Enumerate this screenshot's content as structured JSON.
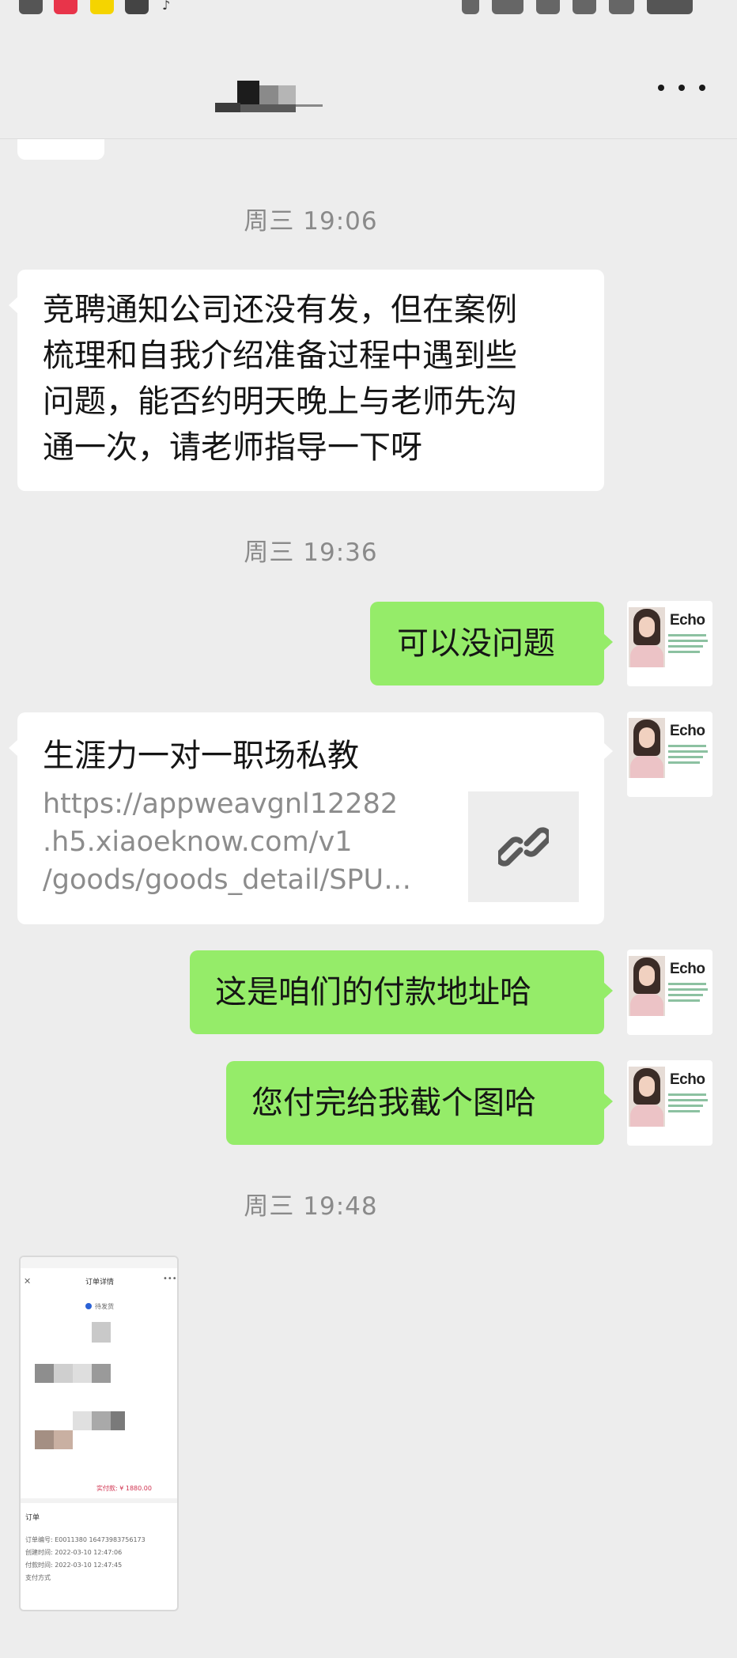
{
  "nav": {
    "title_obscured": true
  },
  "chat": {
    "times": [
      "周三  19:06",
      "周三  19:36",
      "周三  19:48"
    ],
    "messages": {
      "m1": "竞聘通知公司还没有发，但在案例梳理和自我介绍准备过程中遇到些问题，能否约明天晚上与老师先沟通一次，请老师指导一下呀",
      "m1_lines": [
        "竞聘通知公司还没有发，但在案例",
        "梳理和自我介绍准备过程中遇到些",
        "问题，能否约明天晚上与老师先沟",
        "通一次，请老师指导一下呀"
      ],
      "m2": "可以没问题",
      "m4": "这是咱们的付款地址哈",
      "m5": "您付完给我截个图哈"
    },
    "link_card": {
      "title": "生涯力一对一职场私教",
      "url": "https://appweavgnl12282\n.h5.xiaoeknow.com/v1\n/goods/goods_detail/SPU…",
      "icon": "link-icon"
    },
    "avatar": {
      "brand": "Echo"
    },
    "screenshot": {
      "header": "订单详情",
      "status": "待发货",
      "amount": "实付款: ¥ 1880.00",
      "section": "订单",
      "rows": [
        "订单编号: E0011380 16473983756173",
        "创建时间: 2022-03-10 12:47:06",
        "付款时间: 2022-03-10 12:47:45",
        "支付方式"
      ]
    }
  },
  "colors": {
    "background": "#ededed",
    "sent_bubble": "#95ec69",
    "received_bubble": "#ffffff",
    "time_text": "#8a8a8a"
  }
}
